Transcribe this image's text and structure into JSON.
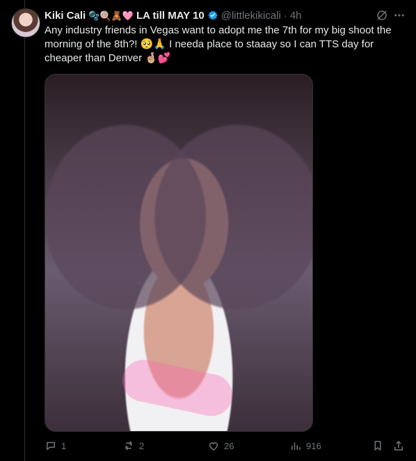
{
  "tweet": {
    "author_name": "Kiki Cali",
    "author_emojis": "🫧🍭🧸🩷",
    "author_suffix": "LA till MAY 10",
    "handle": "@littlekikicali",
    "separator": "·",
    "time": "4h",
    "text": "Any industry friends in Vegas want to adopt me the 7th for my big shoot the morning of the 8th?! 🥺🙏 I needa place to staaay so I can TTS day for cheaper than Denver 🤞🏼💕"
  },
  "actions": {
    "replies": "1",
    "reposts": "2",
    "likes": "26",
    "views": "916"
  },
  "icons": {
    "verified": "verified-badge-icon",
    "grok": "grok-icon",
    "more": "more-icon",
    "reply": "reply-icon",
    "repost": "repost-icon",
    "like": "like-icon",
    "views": "views-icon",
    "bookmark": "bookmark-icon",
    "share": "share-icon"
  },
  "colors": {
    "background": "#000000",
    "text": "#e7e9ea",
    "muted": "#71767b",
    "verified": "#1d9bf0"
  }
}
